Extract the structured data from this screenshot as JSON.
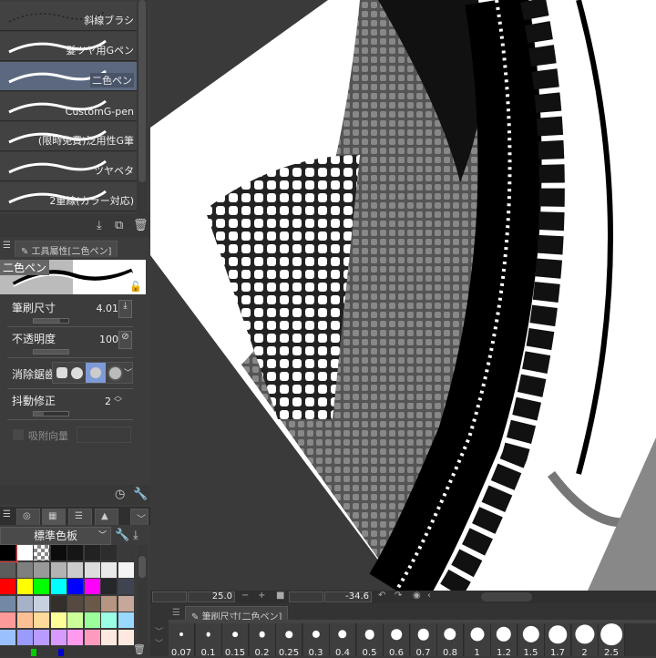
{
  "brush_list": {
    "items": [
      {
        "label": "斜線ブラシ"
      },
      {
        "label": "髮ツヤ用Gペン"
      },
      {
        "label": "二色ペン",
        "selected": true
      },
      {
        "label": "CustomG-pen"
      },
      {
        "label": "(限時免費)泛用性G筆"
      },
      {
        "label": "ツヤベタ"
      },
      {
        "label": "2重線(カラー対応)"
      }
    ]
  },
  "tool_property": {
    "tab_label": "工具屬性[二色ペン]",
    "brush_name": "二色ペン",
    "brush_size": {
      "label": "筆刷尺寸",
      "value": "4.01",
      "fill": 0.75
    },
    "opacity": {
      "label": "不透明度",
      "value": "100",
      "fill": 1.0
    },
    "antialias": {
      "label": "消除鋸齒",
      "selected_index": 2
    },
    "stabilization": {
      "label": "抖動修正",
      "value": "2",
      "fill": 0.3
    },
    "snap": {
      "label": "吸附向量"
    }
  },
  "color_set": {
    "dropdown": "標準色板",
    "selected_index": 0,
    "colors": [
      "#000000",
      "#ffffff",
      "checker",
      "#0c0c0c",
      "#161616",
      "#222222",
      "#2d2d2d",
      "#3a3a3a",
      "#5c5c5c",
      "#7f7f7f",
      "#999999",
      "#b3b3b3",
      "#cccccc",
      "#dddddd",
      "#eaeaea",
      "#f4f4f4",
      "#ff0000",
      "#ffff00",
      "#00ff00",
      "#00ffff",
      "#0000ff",
      "#ff00ff",
      "#26272b",
      "#3f4450",
      "#7288a4",
      "#a5b2c8",
      "#c8d0e0",
      "#332f2a",
      "#564a40",
      "#6a5849",
      "#b79583",
      "#c6a79a",
      "#ff9a9a",
      "#ffbf94",
      "#ffda9a",
      "#ffff9a",
      "#ccff9a",
      "#9aff9a",
      "#9affe5",
      "#9ad8ff",
      "#9ac0ff",
      "#9a9aff",
      "#b99aff",
      "#d99aff",
      "#ff9aee",
      "#ff9abf",
      "#fde9df",
      "#fde9df"
    ]
  },
  "navigator": {
    "zoom": "25.0",
    "rotation": "-34.6"
  },
  "brush_size_panel": {
    "tab_label": "筆刷尺寸[二色ペン]",
    "sizes": [
      "0.07",
      "0.1",
      "0.15",
      "0.2",
      "0.25",
      "0.3",
      "0.4",
      "0.5",
      "0.6",
      "0.7",
      "0.8",
      "1",
      "1.2",
      "1.5",
      "1.7",
      "2",
      "2.5"
    ]
  },
  "colors": {
    "selection": "#5b6880",
    "accent": "#7f9ad8",
    "panel": "#3c3c3c"
  }
}
